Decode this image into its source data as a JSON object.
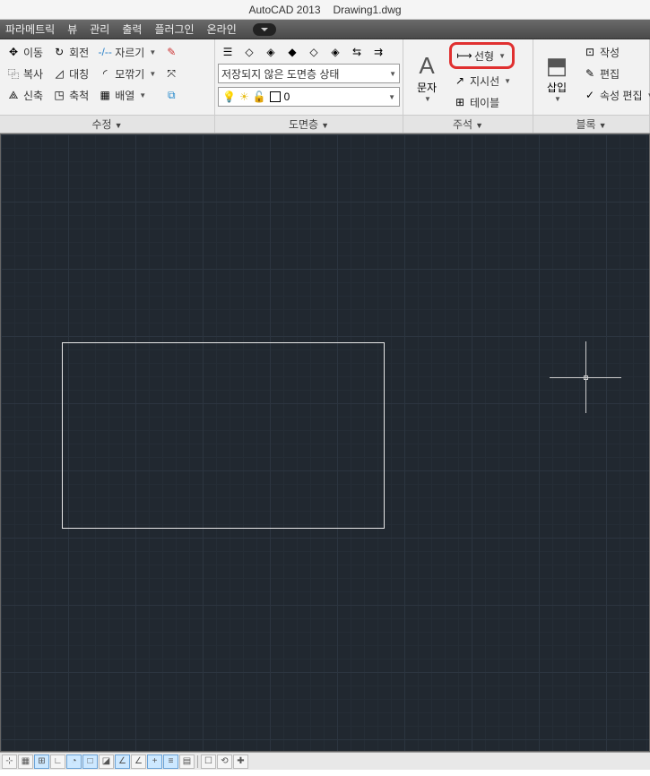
{
  "title": {
    "app": "AutoCAD 2013",
    "file": "Drawing1.dwg"
  },
  "menu": {
    "parametric": "파라메트릭",
    "view": "뷰",
    "manage": "관리",
    "output": "출력",
    "plugin": "플러그인",
    "online": "온라인"
  },
  "ribbon": {
    "modify": {
      "title": "수정",
      "move": "이동",
      "rotate": "회전",
      "trim": "자르기",
      "copy": "복사",
      "mirror": "대칭",
      "fillet": "모깎기",
      "stretch": "신축",
      "scale": "축척",
      "array": "배열"
    },
    "layers": {
      "title": "도면층",
      "unsaved_state": "저장되지 않은 도면층 상태",
      "current_layer": "0"
    },
    "annotation": {
      "title": "주석",
      "text": "문자",
      "linear": "선형",
      "leader": "지시선",
      "table": "테이블"
    },
    "block": {
      "title": "블록",
      "insert": "삽입",
      "create": "작성",
      "edit": "편집",
      "attr_edit": "속성 편집"
    }
  }
}
